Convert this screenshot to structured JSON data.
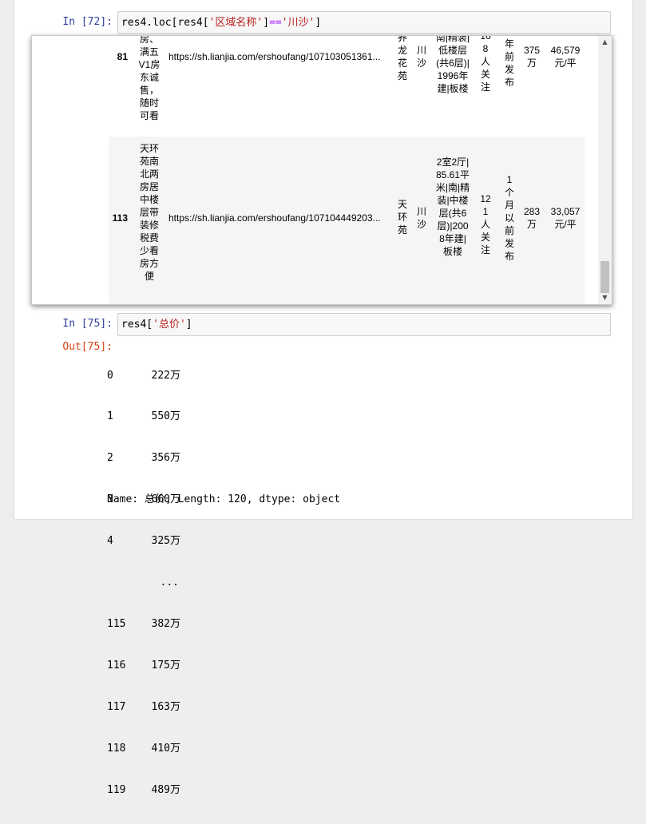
{
  "cells": [
    {
      "prompt": "In  [72]:",
      "code_parts": [
        "res4.loc[res4[",
        "'区域名称'",
        "]",
        "==",
        "'川沙'",
        "]"
      ]
    },
    {
      "prompt": "In  [75]:",
      "code_parts": [
        "res4[",
        "'总价'",
        "]"
      ],
      "out_prompt": "Out[75]:"
    }
  ],
  "table_rows": [
    {
      "index": "81",
      "title": "房、满五V1房东诚售，随时可看",
      "url": "https://sh.lianjia.com/ershoufang/107103051361...",
      "community": "养龙花苑",
      "district": "川沙",
      "info": "南|精装|低楼层(共6层)|1996年建|板楼",
      "followers": "168人关注",
      "publish": "年前发布",
      "total_price": "375万",
      "unit_price": "46,579元/平"
    },
    {
      "index": "113",
      "title": "天环苑南北两房居中楼层带装修税费少看房方便",
      "url": "https://sh.lianjia.com/ershoufang/107104449203...",
      "community": "天环苑",
      "district": "川沙",
      "info": "2室2厅|85.61平米|南|精装|中楼层(共6层)|2008年建|板楼",
      "followers": "121人关注",
      "publish": "1个月以前发布",
      "total_price": "283万",
      "unit_price": "33,057元/平"
    }
  ],
  "series_output": [
    {
      "idx": "0",
      "val": "222万"
    },
    {
      "idx": "1",
      "val": "550万"
    },
    {
      "idx": "2",
      "val": "356万"
    },
    {
      "idx": "3",
      "val": "660万"
    },
    {
      "idx": "4",
      "val": "325万"
    },
    {
      "idx": "",
      "val": "..."
    },
    {
      "idx": "115",
      "val": "382万"
    },
    {
      "idx": "116",
      "val": "175万"
    },
    {
      "idx": "117",
      "val": "163万"
    },
    {
      "idx": "118",
      "val": "410万"
    },
    {
      "idx": "119",
      "val": "489万"
    }
  ],
  "series_footer": "Name: 总价, Length: 120, dtype: object",
  "scrollbar": {
    "up": "▲",
    "down": "▼"
  }
}
